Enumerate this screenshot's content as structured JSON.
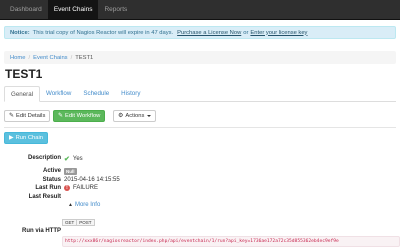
{
  "navbar": {
    "items": [
      {
        "label": "Dashboard",
        "active": false
      },
      {
        "label": "Event Chains",
        "active": true
      },
      {
        "label": "Reports",
        "active": false
      }
    ]
  },
  "notice": {
    "prefix": "Notice:",
    "text": "This trial copy of Nagios Reactor will expire in 47 days.",
    "link1": "Purchase a License Now",
    "or": "or",
    "link2": "Enter your license key"
  },
  "breadcrumb": {
    "home": "Home",
    "section": "Event Chains",
    "current": "TEST1"
  },
  "page": {
    "title": "TEST1"
  },
  "tabs": [
    {
      "label": "General",
      "active": true
    },
    {
      "label": "Workflow",
      "active": false
    },
    {
      "label": "Schedule",
      "active": false
    },
    {
      "label": "History",
      "active": false
    }
  ],
  "toolbar": {
    "edit_details": "Edit Details",
    "edit_workflow": "Edit Workflow",
    "actions": "Actions"
  },
  "run_chain": "Run Chain",
  "details": {
    "description_label": "Description",
    "description_value": "Yes",
    "active_label": "Active",
    "active_badge": "Null",
    "status_label": "Status",
    "status_value": "2015-04-16 14:15:55",
    "last_run_label": "Last Run",
    "last_run_value": "FAILURE",
    "last_result_label": "Last Result",
    "more_info": "More Info",
    "http_label": "Run via HTTP",
    "get_label": "GET",
    "post_label": "POST",
    "url": "http://xxx86r/nagiosreactor/index.php/api/eventchain/1/run?api_key=1736ae172a72c35d855362eb4ec9ef9e"
  },
  "colors": {
    "navbar": "#2f2f2f",
    "notice_bg": "#d9edf7",
    "link": "#428bca",
    "success": "#5cb85c",
    "info": "#5bc0de",
    "danger": "#d9534f"
  },
  "icons": {
    "edit_details": "pencil-icon",
    "edit_workflow": "pencil-icon",
    "actions": "gear-icon",
    "run_chain": "play-icon",
    "description": "check-icon",
    "last_run": "error-icon",
    "more_info": "chevron-down-icon"
  }
}
